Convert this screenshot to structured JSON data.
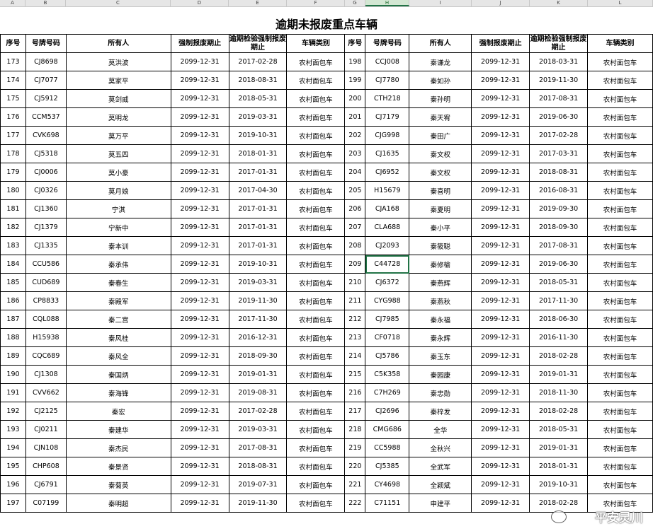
{
  "column_letters": [
    "A",
    "B",
    "C",
    "D",
    "E",
    "F",
    "G",
    "H",
    "I",
    "J",
    "K",
    "L"
  ],
  "title": "逾期未报废重点车辆",
  "headers": [
    "序号",
    "号牌号码",
    "所有人",
    "强制报废期止",
    "逾期检验强制报废期止",
    "车辆类别",
    "序号",
    "号牌号码",
    "所有人",
    "强制报废期止",
    "逾期检验强制报废期止",
    "车辆类别"
  ],
  "rows": [
    [
      "173",
      "CJ8698",
      "莫洪波",
      "2099-12-31",
      "2017-02-28",
      "农村面包车",
      "198",
      "CCJ008",
      "秦谦龙",
      "2099-12-31",
      "2018-03-31",
      "农村面包车"
    ],
    [
      "174",
      "CJ7077",
      "莫家平",
      "2099-12-31",
      "2018-08-31",
      "农村面包车",
      "199",
      "CJ7780",
      "秦如孙",
      "2099-12-31",
      "2019-11-30",
      "农村面包车"
    ],
    [
      "175",
      "CJ5912",
      "莫剑威",
      "2099-12-31",
      "2018-05-31",
      "农村面包车",
      "200",
      "CTH218",
      "秦孙明",
      "2099-12-31",
      "2017-08-31",
      "农村面包车"
    ],
    [
      "176",
      "CCM537",
      "莫明龙",
      "2099-12-31",
      "2019-03-31",
      "农村面包车",
      "201",
      "CJ7179",
      "秦天宥",
      "2099-12-31",
      "2019-06-30",
      "农村面包车"
    ],
    [
      "177",
      "CVK698",
      "莫万平",
      "2099-12-31",
      "2019-10-31",
      "农村面包车",
      "202",
      "CJG998",
      "秦田广",
      "2099-12-31",
      "2017-02-28",
      "农村面包车"
    ],
    [
      "178",
      "CJ5318",
      "莫五四",
      "2099-12-31",
      "2018-01-31",
      "农村面包车",
      "203",
      "CJ1635",
      "秦文权",
      "2099-12-31",
      "2017-03-31",
      "农村面包车"
    ],
    [
      "179",
      "CJ0006",
      "莫小豪",
      "2099-12-31",
      "2017-01-31",
      "农村面包车",
      "204",
      "CJ6952",
      "秦文权",
      "2099-12-31",
      "2018-08-31",
      "农村面包车"
    ],
    [
      "180",
      "CJ0326",
      "莫月娘",
      "2099-12-31",
      "2017-04-30",
      "农村面包车",
      "205",
      "H15679",
      "秦喜明",
      "2099-12-31",
      "2016-08-31",
      "农村面包车"
    ],
    [
      "181",
      "CJ1360",
      "宁淇",
      "2099-12-31",
      "2017-01-31",
      "农村面包车",
      "206",
      "CJA168",
      "秦夏明",
      "2099-12-31",
      "2019-09-30",
      "农村面包车"
    ],
    [
      "182",
      "CJ1379",
      "宁新中",
      "2099-12-31",
      "2017-01-31",
      "农村面包车",
      "207",
      "CLA688",
      "秦小平",
      "2099-12-31",
      "2018-09-30",
      "农村面包车"
    ],
    [
      "183",
      "CJ1335",
      "秦本训",
      "2099-12-31",
      "2017-01-31",
      "农村面包车",
      "208",
      "CJ2093",
      "秦筱聪",
      "2099-12-31",
      "2017-08-31",
      "农村面包车"
    ],
    [
      "184",
      "CCU586",
      "秦承伟",
      "2099-12-31",
      "2019-10-31",
      "农村面包车",
      "209",
      "C44728",
      "秦修榆",
      "2099-12-31",
      "2019-06-30",
      "农村面包车"
    ],
    [
      "185",
      "CUD689",
      "秦春生",
      "2099-12-31",
      "2019-03-31",
      "农村面包车",
      "210",
      "CJ6372",
      "秦燕辉",
      "2099-12-31",
      "2018-05-31",
      "农村面包车"
    ],
    [
      "186",
      "CP8833",
      "秦殿军",
      "2099-12-31",
      "2019-11-30",
      "农村面包车",
      "211",
      "CYG988",
      "秦燕秋",
      "2099-12-31",
      "2017-11-30",
      "农村面包车"
    ],
    [
      "187",
      "CQL088",
      "秦二宫",
      "2099-12-31",
      "2017-11-30",
      "农村面包车",
      "212",
      "CJ7985",
      "秦永福",
      "2099-12-31",
      "2018-06-30",
      "农村面包车"
    ],
    [
      "188",
      "H15938",
      "秦风桂",
      "2099-12-31",
      "2016-12-31",
      "农村面包车",
      "213",
      "CF0718",
      "秦永辉",
      "2099-12-31",
      "2016-11-30",
      "农村面包车"
    ],
    [
      "189",
      "CQC689",
      "秦风全",
      "2099-12-31",
      "2018-09-30",
      "农村面包车",
      "214",
      "CJ5786",
      "秦玉东",
      "2099-12-31",
      "2018-02-28",
      "农村面包车"
    ],
    [
      "190",
      "CJ1308",
      "秦国炳",
      "2099-12-31",
      "2019-01-31",
      "农村面包车",
      "215",
      "C5K358",
      "秦园康",
      "2099-12-31",
      "2019-01-31",
      "农村面包车"
    ],
    [
      "191",
      "CVV662",
      "秦海锋",
      "2099-12-31",
      "2019-08-31",
      "农村面包车",
      "216",
      "C7H269",
      "秦忠勋",
      "2099-12-31",
      "2018-11-30",
      "农村面包车"
    ],
    [
      "192",
      "CJ2125",
      "秦宏",
      "2099-12-31",
      "2017-02-28",
      "农村面包车",
      "217",
      "CJ2696",
      "秦梓发",
      "2099-12-31",
      "2018-02-28",
      "农村面包车"
    ],
    [
      "193",
      "CJ0211",
      "秦建华",
      "2099-12-31",
      "2019-03-31",
      "农村面包车",
      "218",
      "CMG686",
      "全华",
      "2099-12-31",
      "2018-05-31",
      "农村面包车"
    ],
    [
      "194",
      "CJN108",
      "秦杰民",
      "2099-12-31",
      "2017-08-31",
      "农村面包车",
      "219",
      "CC5988",
      "全秋兴",
      "2099-12-31",
      "2019-01-31",
      "农村面包车"
    ],
    [
      "195",
      "CHP608",
      "秦景贤",
      "2099-12-31",
      "2018-08-31",
      "农村面包车",
      "220",
      "CJ5385",
      "全武军",
      "2099-12-31",
      "2018-01-31",
      "农村面包车"
    ],
    [
      "196",
      "CJ6791",
      "秦菊英",
      "2099-12-31",
      "2019-07-31",
      "农村面包车",
      "221",
      "CY4698",
      "全颖斌",
      "2099-12-31",
      "2019-10-31",
      "农村面包车"
    ],
    [
      "197",
      "C07199",
      "秦明超",
      "2099-12-31",
      "2019-11-30",
      "农村面包车",
      "222",
      "C71151",
      "申建平",
      "2099-12-31",
      "2018-02-28",
      "农村面包车"
    ]
  ],
  "watermark": "平安灵川",
  "accent_color": "#217346"
}
